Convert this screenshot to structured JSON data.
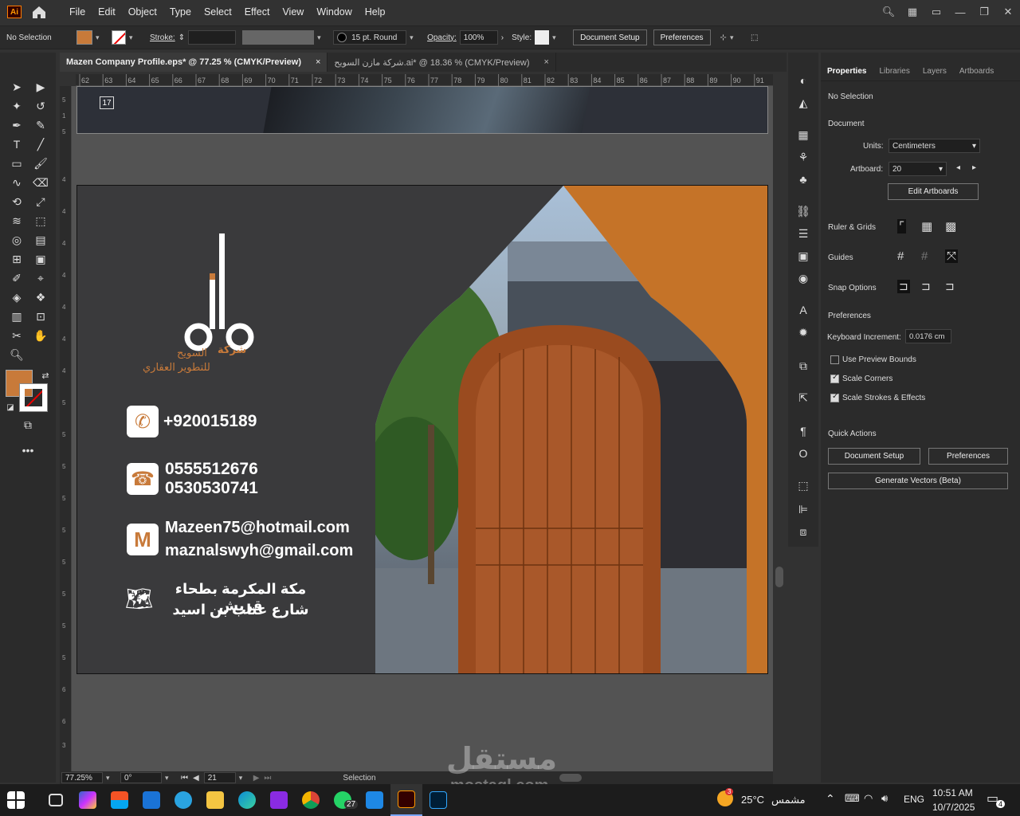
{
  "menubar": {
    "app_icon": "Ai",
    "menu": [
      "File",
      "Edit",
      "Object",
      "Type",
      "Select",
      "Effect",
      "View",
      "Window",
      "Help"
    ]
  },
  "control": {
    "selection": "No Selection",
    "stroke_label": "Stroke:",
    "brush": "15 pt. Round",
    "opacity_label": "Opacity:",
    "opacity_value": "100%",
    "style_label": "Style:",
    "doc_setup": "Document Setup",
    "preferences": "Preferences"
  },
  "tabs": [
    {
      "label": "Mazen Company Profile.eps* @ 77.25 % (CMYK/Preview)",
      "close": "×"
    },
    {
      "label": "شركة مازن السويح.ai* @ 18.36 % (CMYK/Preview)",
      "close": "×"
    }
  ],
  "ruler_top": [
    "62",
    "63",
    "64",
    "65",
    "66",
    "67",
    "68",
    "69",
    "70",
    "71",
    "72",
    "73",
    "74",
    "75",
    "76",
    "77",
    "78",
    "79",
    "80",
    "81",
    "82",
    "83",
    "84",
    "85",
    "86",
    "87",
    "88",
    "89",
    "90",
    "91"
  ],
  "artboard_number": "17",
  "artboard": {
    "phone1": "+920015189",
    "phone2": "0555512676",
    "phone3": "0530530741",
    "email1": "Mazeen75@hotmail.com",
    "email2": "maznalswyh@gmail.com",
    "address1": "مكة المكرمة بطحاء قريش",
    "address2": "شارع عتاب بن اسيد",
    "logo_line1": "شركة",
    "logo_line2": "السويح",
    "logo_line3": "للتطوير العقاري"
  },
  "status": {
    "zoom": "77.25%",
    "rotation": "0°",
    "artboard": "21",
    "tool": "Selection"
  },
  "props": {
    "tabs": [
      "Properties",
      "Libraries",
      "Layers",
      "Artboards"
    ],
    "no_selection": "No Selection",
    "document": "Document",
    "units_label": "Units:",
    "units_value": "Centimeters",
    "artboard_label": "Artboard:",
    "artboard_value": "20",
    "edit_artboards": "Edit Artboards",
    "ruler_grids": "Ruler & Grids",
    "guides": "Guides",
    "snap": "Snap Options",
    "preferences": "Preferences",
    "kb_label": "Keyboard Increment:",
    "kb_value": "0.0176 cm",
    "preview_bounds": "Use Preview Bounds",
    "scale_corners": "Scale Corners",
    "scale_strokes": "Scale Strokes & Effects",
    "quick_actions": "Quick Actions",
    "doc_setup": "Document Setup",
    "prefs_btn": "Preferences",
    "gen_vectors": "Generate Vectors (Beta)"
  },
  "taskbar": {
    "weather_temp": "25°C",
    "weather_text": "مشمس",
    "lang": "ENG",
    "time": "10:51 AM",
    "date": "10/7/2025",
    "whatsapp_badge": "27",
    "notif_badge": "4",
    "weather_badge": "3"
  },
  "watermark": {
    "line1": "مستقل",
    "line2": "mostaql.com"
  },
  "colors": {
    "accent": "#c87a3a",
    "orange": "#d77f2b",
    "card_bg": "#3a3a3c"
  }
}
